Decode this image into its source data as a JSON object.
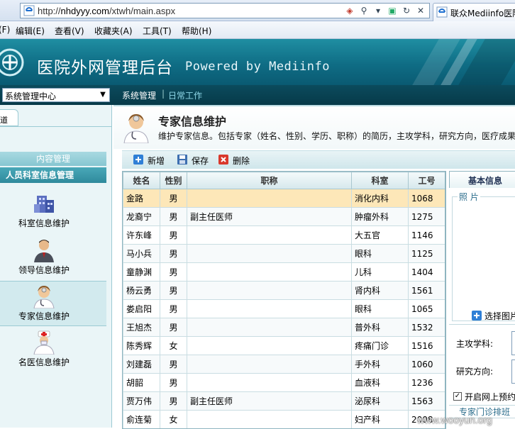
{
  "browser": {
    "url_scheme": "http://",
    "url_host": "nhdyyy.com",
    "url_path": "/xtwh/main.aspx",
    "tab_title": "联众Mediinfo医院"
  },
  "menu": [
    "(F)",
    "编辑(E)",
    "查看(V)",
    "收藏夹(A)",
    "工具(T)",
    "帮助(H)"
  ],
  "banner": {
    "title": "医院外网管理后台",
    "powered": "Powered by Mediinfo"
  },
  "navbar": {
    "system_select": "系统管理中心",
    "nav_system": "系统管理",
    "separator": "|",
    "nav_daily": "日常工作"
  },
  "sidebar": {
    "tab_stub": "道",
    "content_header": "内容管理",
    "section_header": "人员科室信息管理",
    "items": [
      {
        "label": "科室信息维护",
        "icon": "building-icon"
      },
      {
        "label": "领导信息维护",
        "icon": "leader-icon"
      },
      {
        "label": "专家信息维护",
        "icon": "expert-icon"
      },
      {
        "label": "名医信息维护",
        "icon": "doctor-icon"
      }
    ]
  },
  "page": {
    "title": "专家信息维护",
    "description": "维护专家信息。包括专家（姓名、性别、学历、职称）的简历，主攻学科，研究方向，医疗成果"
  },
  "toolbar": {
    "add": "新增",
    "save": "保存",
    "delete": "删除"
  },
  "grid": {
    "columns": [
      "姓名",
      "性别",
      "职称",
      "科室",
      "工号"
    ],
    "rows": [
      [
        "金路",
        "男",
        "",
        "消化内科",
        "1068"
      ],
      [
        "龙裔宁",
        "男",
        "副主任医师",
        "肿瘤外科",
        "1275"
      ],
      [
        "许东峰",
        "男",
        "",
        "大五官",
        "1146"
      ],
      [
        "马小兵",
        "男",
        "",
        "眼科",
        "1125"
      ],
      [
        "童静渊",
        "男",
        "",
        "儿科",
        "1404"
      ],
      [
        "杨云勇",
        "男",
        "",
        "肾内科",
        "1561"
      ],
      [
        "娄启阳",
        "男",
        "",
        "眼科",
        "1065"
      ],
      [
        "王旭杰",
        "男",
        "",
        "普外科",
        "1532"
      ],
      [
        "陈秀辉",
        "女",
        "",
        "疼痛门诊",
        "1516"
      ],
      [
        "刘建磊",
        "男",
        "",
        "手外科",
        "1060"
      ],
      [
        "胡韶",
        "男",
        "",
        "血液科",
        "1236"
      ],
      [
        "贾万伟",
        "男",
        "副主任医师",
        "泌尿科",
        "1563"
      ],
      [
        "俞连菊",
        "女",
        "",
        "妇产科",
        "2008"
      ]
    ]
  },
  "detail": {
    "tab": "基本信息",
    "photo_label": "照 片",
    "pick_photo": "选择图片",
    "field_subject": "主攻学科:",
    "field_research": "研究方向:",
    "online_booking": "开启网上预约",
    "schedule": "专家门诊排班",
    "checked_mark": "✓"
  },
  "watermark": "www.wooyun.org",
  "colors": {
    "banner": "#0f6d85",
    "selected_row": "#fde7b8",
    "navbar": "#073a49"
  }
}
